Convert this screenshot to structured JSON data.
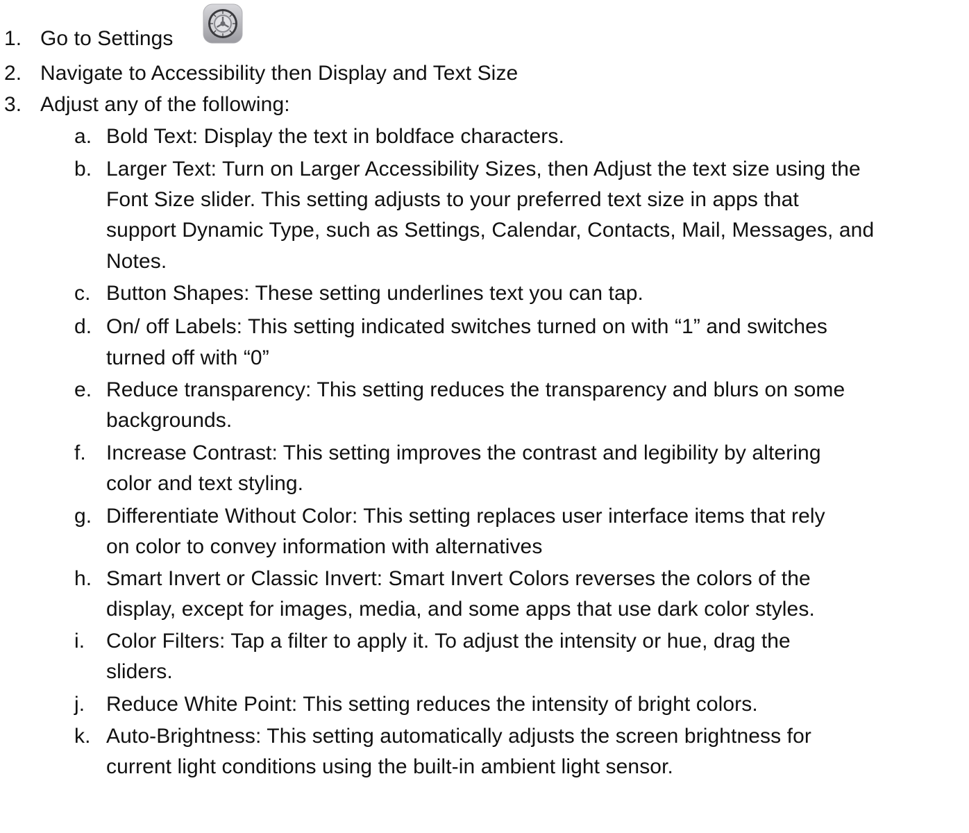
{
  "steps": [
    {
      "num": "1.",
      "text": "Go to Settings"
    },
    {
      "num": "2.",
      "text": "Navigate to Accessibility then Display and Text Size"
    },
    {
      "num": "3.",
      "text": "Adjust any of the following:"
    }
  ],
  "settings_icon": {
    "icon": "gear-icon",
    "color": "#8e8e93"
  },
  "items": [
    {
      "letter": "a.",
      "lines": [
        "Bold Text: Display the text in boldface characters."
      ]
    },
    {
      "letter": "b.",
      "lines": [
        "Larger Text: Turn on Larger Accessibility Sizes, then Adjust the text size using the",
        "Font Size slider. This setting adjusts to your preferred text size in apps that",
        "support Dynamic Type, such as Settings, Calendar, Contacts, Mail, Messages, and",
        "Notes."
      ]
    },
    {
      "letter": "c.",
      "lines": [
        "Button Shapes: These setting underlines text you can tap."
      ]
    },
    {
      "letter": "d.",
      "lines": [
        "On/ off Labels: This setting indicated switches turned on with “1” and switches",
        "turned off with “0”"
      ]
    },
    {
      "letter": "e.",
      "lines": [
        "Reduce transparency: This setting reduces the transparency and blurs on some",
        "backgrounds."
      ]
    },
    {
      "letter": "f.",
      "lines": [
        "Increase Contrast: This setting improves the contrast and legibility by altering",
        "color and text styling."
      ]
    },
    {
      "letter": "g.",
      "lines": [
        "Differentiate Without Color: This setting replaces user interface items that rely",
        "on color to convey information with alternatives"
      ]
    },
    {
      "letter": "h.",
      "lines": [
        "Smart Invert or Classic Invert: Smart Invert Colors reverses the colors of the",
        "display, except for images, media, and some apps that use dark color styles."
      ]
    },
    {
      "letter": "i.",
      "lines": [
        "Color Filters: Tap a filter to apply it. To adjust the intensity or hue, drag the",
        "sliders."
      ]
    },
    {
      "letter": "j.",
      "lines": [
        "Reduce White Point: This setting reduces the intensity of bright colors."
      ]
    },
    {
      "letter": "k.",
      "lines": [
        "Auto-Brightness: This setting automatically adjusts the screen brightness for",
        "current light conditions using the built-in ambient light sensor."
      ]
    }
  ]
}
